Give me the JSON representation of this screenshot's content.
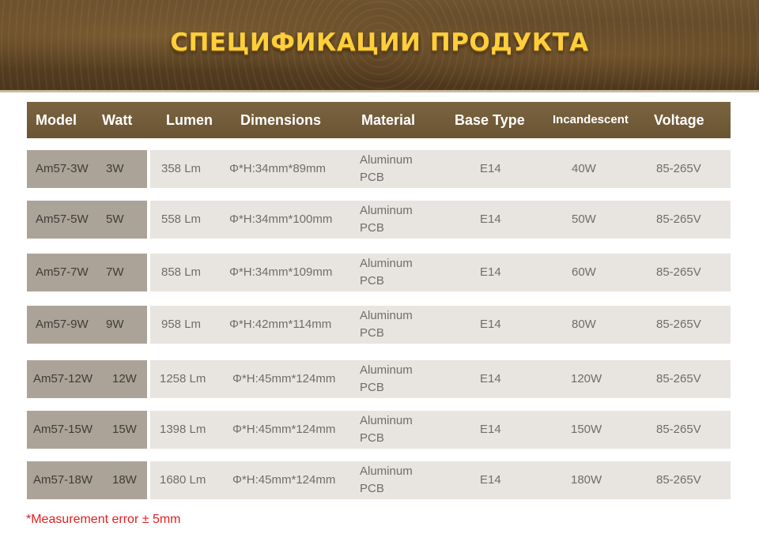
{
  "banner": {
    "title": "СПЕЦИФИКАЦИИ ПРОДУКТА"
  },
  "header": {
    "model": "Model",
    "watt": "Watt",
    "lumen": "Lumen",
    "dimensions": "Dimensions",
    "material": "Material",
    "base_type": "Base Type",
    "incandescent": "Incandescent",
    "voltage": "Voltage"
  },
  "rows": [
    {
      "model": "Am57-3W",
      "watt": "3W",
      "lumen": "358 Lm",
      "dimensions": "Φ*H:34mm*89mm",
      "material_1": "Aluminum",
      "material_2": "PCB",
      "base": "E14",
      "incandescent": "40W",
      "voltage": "85-265V"
    },
    {
      "model": "Am57-5W",
      "watt": "5W",
      "lumen": "558 Lm",
      "dimensions": "Φ*H:34mm*100mm",
      "material_1": "Aluminum",
      "material_2": "PCB",
      "base": "E14",
      "incandescent": "50W",
      "voltage": "85-265V"
    },
    {
      "model": "Am57-7W",
      "watt": "7W",
      "lumen": "858 Lm",
      "dimensions": "Φ*H:34mm*109mm",
      "material_1": "Aluminum",
      "material_2": "PCB",
      "base": "E14",
      "incandescent": "60W",
      "voltage": "85-265V"
    },
    {
      "model": "Am57-9W",
      "watt": "9W",
      "lumen": "958 Lm",
      "dimensions": "Φ*H:42mm*114mm",
      "material_1": "Aluminum",
      "material_2": "PCB",
      "base": "E14",
      "incandescent": "80W",
      "voltage": "85-265V"
    },
    {
      "model": "Am57-12W",
      "watt": "12W",
      "lumen": "1258 Lm",
      "dimensions": "Φ*H:45mm*124mm",
      "material_1": "Aluminum",
      "material_2": "PCB",
      "base": "E14",
      "incandescent": "120W",
      "voltage": "85-265V"
    },
    {
      "model": "Am57-15W",
      "watt": "15W",
      "lumen": "1398 Lm",
      "dimensions": "Φ*H:45mm*124mm",
      "material_1": "Aluminum",
      "material_2": "PCB",
      "base": "E14",
      "incandescent": "150W",
      "voltage": "85-265V"
    },
    {
      "model": "Am57-18W",
      "watt": "18W",
      "lumen": "1680 Lm",
      "dimensions": "Φ*H:45mm*124mm",
      "material_1": "Aluminum",
      "material_2": "PCB",
      "base": "E14",
      "incandescent": "180W",
      "voltage": "85-265V"
    }
  ],
  "note": "*Measurement error ± 5mm",
  "colors": {
    "banner_text": "#ffcf3a",
    "header_bg": "#6e5836",
    "model_cell_bg": "#aca398",
    "row_bg": "#e8e5e0",
    "note_text": "#e02020"
  }
}
